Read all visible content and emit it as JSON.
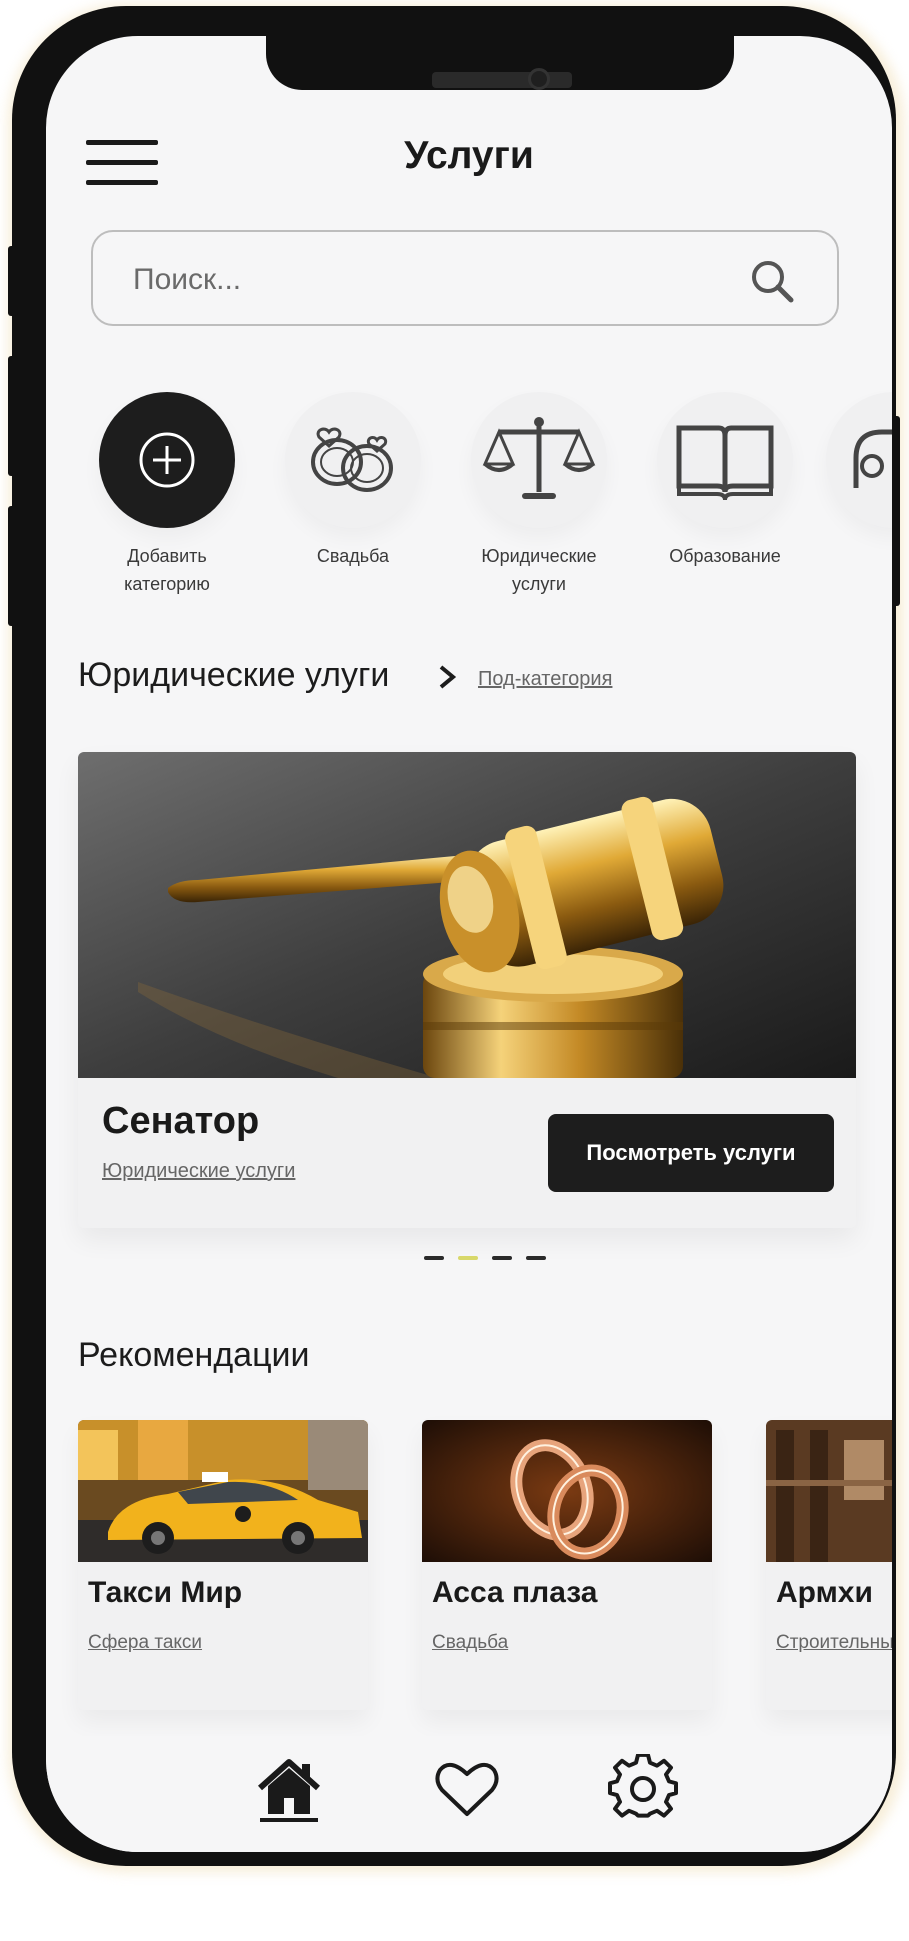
{
  "header": {
    "title": "Услуги"
  },
  "search": {
    "placeholder": "Поиск..."
  },
  "categories": [
    {
      "label": "Добавить категорию",
      "icon": "plus-circle-icon"
    },
    {
      "label": "Свадьба",
      "icon": "wedding-rings-icon"
    },
    {
      "label": "Юридические услуги",
      "icon": "scales-icon"
    },
    {
      "label": "Образование",
      "icon": "book-icon"
    }
  ],
  "section": {
    "title": "Юридические улуги",
    "sub_link": "Под-категория"
  },
  "featured": {
    "name": "Сенатор",
    "category": "Юридические услуги",
    "button": "Посмотреть услуги",
    "image": "gavel-photo"
  },
  "carousel": {
    "count": 4,
    "active_index": 1,
    "active_color": "#d8d86a"
  },
  "recommendations": {
    "title": "Рекомендации",
    "items": [
      {
        "name": "Такси Мир",
        "category": "Сфера такси",
        "image": "taxi-photo"
      },
      {
        "name": "Асса плаза",
        "category": "Свадьба",
        "image": "rings-photo"
      },
      {
        "name": "Армхи",
        "category": "Строительные услуги",
        "image": "building-photo"
      }
    ]
  },
  "tabbar": {
    "items": [
      "home-icon",
      "heart-icon",
      "settings-icon"
    ],
    "active": "home-icon"
  },
  "colors": {
    "dark": "#1d1d1d",
    "background": "#f6f6f7",
    "frame": "#111111"
  }
}
